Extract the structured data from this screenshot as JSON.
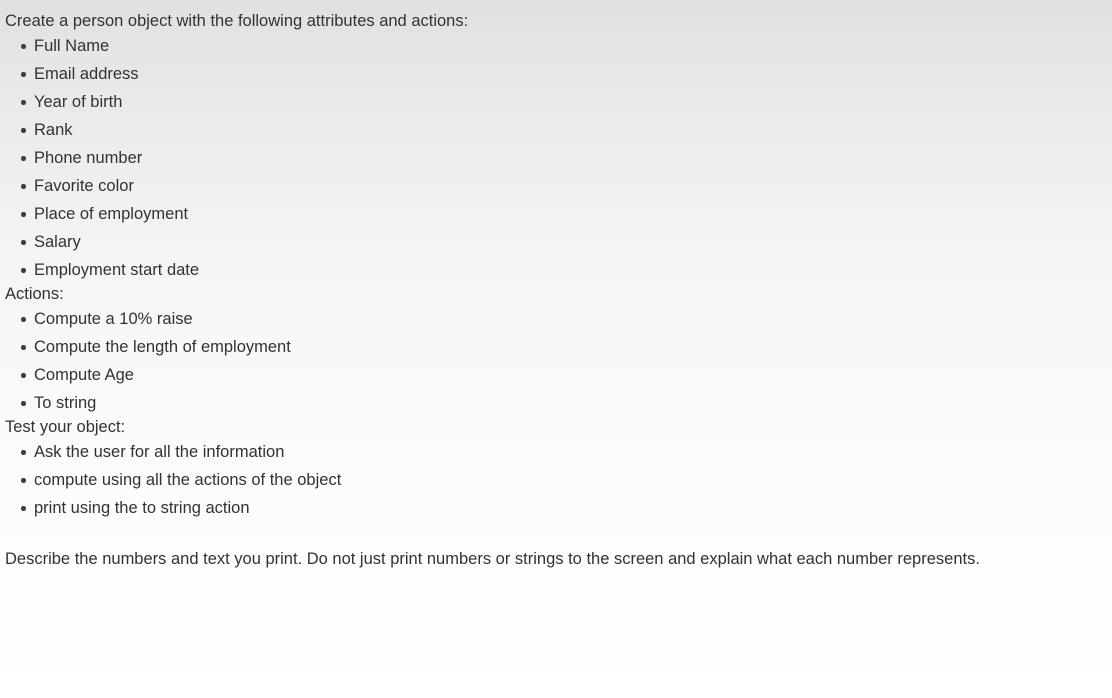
{
  "document": {
    "lead_paragraph": "Create a person object with the following attributes and actions:",
    "attributes": [
      "Full Name",
      "Email address",
      "Year of birth",
      "Rank",
      "Phone number",
      "Favorite color",
      "Place of employment",
      "Salary",
      "Employment start date"
    ],
    "actions_heading": "Actions:",
    "actions": [
      "Compute a 10% raise",
      "Compute the length of employment",
      "Compute Age",
      "To string"
    ],
    "test_heading": "Test your object:",
    "test_steps": [
      "Ask the user for all the information",
      "compute using all the actions of the object",
      "print using the to string action"
    ],
    "closing_paragraph": "Describe the numbers and text you print. Do not just print numbers or strings to the screen and explain what each number represents."
  },
  "style": {
    "text_color": "#2f3337",
    "bullet_color": "#3a3f44",
    "background_top": "#e0e0e0",
    "background_bottom": "#ffffff"
  }
}
